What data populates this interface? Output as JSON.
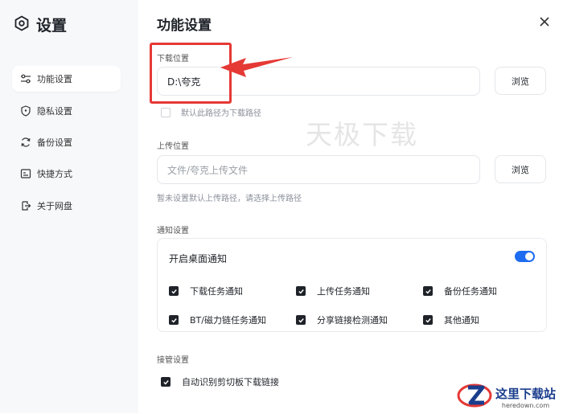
{
  "app": {
    "title": "设置"
  },
  "sidebar": {
    "items": [
      {
        "label": "功能设置",
        "icon": "sliders-icon",
        "active": true
      },
      {
        "label": "隐私设置",
        "icon": "shield-icon",
        "active": false
      },
      {
        "label": "备份设置",
        "icon": "sync-icon",
        "active": false
      },
      {
        "label": "快捷方式",
        "icon": "shortcut-icon",
        "active": false
      },
      {
        "label": "关于网盘",
        "icon": "info-icon",
        "active": false
      }
    ]
  },
  "main": {
    "heading": "功能设置",
    "download": {
      "label": "下载位置",
      "value": "D:\\夸克",
      "browse_label": "浏览",
      "default_checkbox_label": "默认此路径为下载路径",
      "default_checked": false
    },
    "upload": {
      "label": "上传位置",
      "placeholder": "文件/夸克上传文件",
      "browse_label": "浏览",
      "hint": "暂未设置默认上传路径，请选择上传路径"
    },
    "notifications": {
      "label": "通知设置",
      "desktop_label": "开启桌面通知",
      "desktop_enabled": true,
      "options": [
        {
          "label": "下载任务通知",
          "checked": true
        },
        {
          "label": "上传任务通知",
          "checked": true
        },
        {
          "label": "备份任务通知",
          "checked": true
        },
        {
          "label": "BT/磁力链任务通知",
          "checked": true
        },
        {
          "label": "分享链接检测通知",
          "checked": true
        },
        {
          "label": "其他通知",
          "checked": true
        }
      ]
    },
    "takeover": {
      "label": "接管设置",
      "clipboard_label": "自动识别剪切板下载链接",
      "clipboard_checked": true
    }
  },
  "overlay": {
    "watermark": "天极下载",
    "logo_cn": "这里下载站",
    "logo_en": "heredown.com"
  },
  "colors": {
    "accent": "#1e6cf0",
    "annotation": "#e53935",
    "sidebar_bg": "#f7f8fa"
  }
}
